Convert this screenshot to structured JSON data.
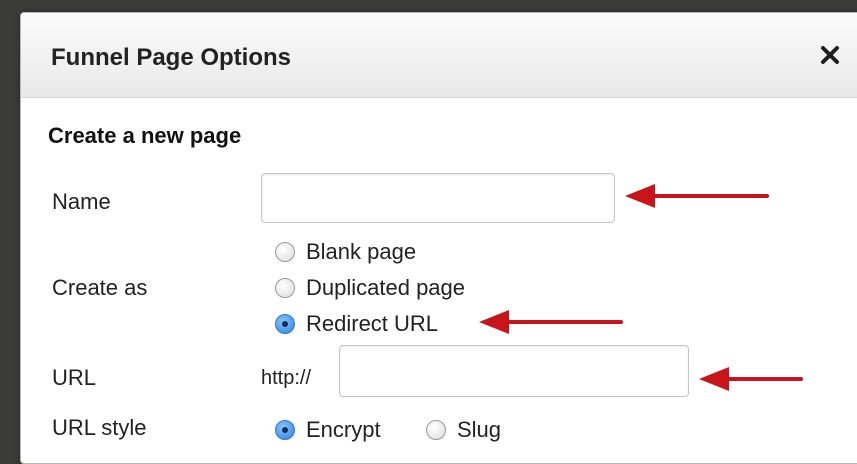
{
  "dialog": {
    "title": "Funnel Page Options",
    "close_icon": "close-icon",
    "section_heading": "Create a new page"
  },
  "form": {
    "name": {
      "label": "Name",
      "value": ""
    },
    "create_as": {
      "label": "Create as",
      "options": [
        {
          "label": "Blank page",
          "selected": false
        },
        {
          "label": "Duplicated page",
          "selected": false
        },
        {
          "label": "Redirect URL",
          "selected": true
        }
      ]
    },
    "url": {
      "label": "URL",
      "prefix": "http://",
      "value": ""
    },
    "url_style": {
      "label": "URL style",
      "options": [
        {
          "label": "Encrypt",
          "selected": true
        },
        {
          "label": "Slug",
          "selected": false
        }
      ]
    }
  },
  "annotation_color": "#c8141a",
  "colors": {
    "radio_selected": "#2c7fd6"
  }
}
